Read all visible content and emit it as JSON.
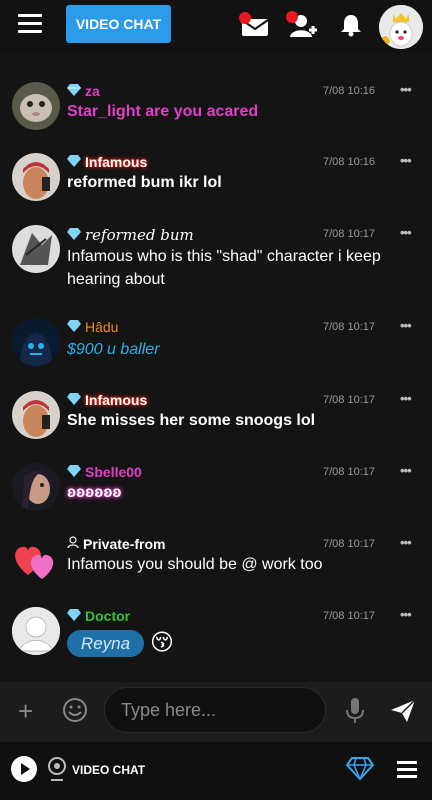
{
  "header": {
    "video_chat_label": "VIDEO CHAT",
    "colors": {
      "accent": "#2b9bea",
      "notify": "#e8191f"
    }
  },
  "messages": [
    {
      "name": "za",
      "name_color": "#e23ec8",
      "badge": "diamond",
      "time": "7/08 10:16",
      "text": "Star_light are you acared",
      "text_color": "#e23ec8",
      "text_style": "bold"
    },
    {
      "name": "Infamous",
      "name_color": "#ffffff",
      "name_glow": "#d11",
      "badge": "diamond",
      "time": "7/08 10:16",
      "text": "reformed bum ikr lol",
      "text_color": "#ffffff",
      "text_style": "bold"
    },
    {
      "name": "reformed bum",
      "name_color": "#ffffff",
      "badge": "diamond",
      "time": "7/08 10:17",
      "text": "Infamous who is this \"shad\" character i keep hearing about",
      "text_color": "#ffffff",
      "text_style": "normal"
    },
    {
      "name": "Hâdu",
      "name_color": "#f08a24",
      "badge": "diamond",
      "time": "7/08 10:17",
      "text": "$900 u baller",
      "text_color": "#2bb0e8",
      "text_style": "italic"
    },
    {
      "name": "Infamous",
      "name_color": "#ffffff",
      "name_glow": "#d11",
      "badge": "diamond",
      "time": "7/08 10:17",
      "text": "She misses her some snoogs lol",
      "text_color": "#ffffff",
      "text_style": "bold"
    },
    {
      "name": "Sbelle00",
      "name_color": "#e23ec8",
      "badge": "diamond",
      "time": "7/08 10:17",
      "text": "ʚʚʚʚʚʚ",
      "text_color": "#ffffff",
      "text_style": "bold"
    },
    {
      "name": "Private-from",
      "name_color": "#ffffff",
      "badge": "person",
      "time": "7/08 10:17",
      "text": "Infamous you should be @ work too",
      "text_color": "#ffffff",
      "text_style": "normal"
    },
    {
      "name": "Doctor",
      "name_color": "#36c23a",
      "badge": "diamond",
      "time": "7/08 10:17",
      "sticker": "Reyna",
      "emoji": "😚"
    }
  ],
  "composer": {
    "placeholder": "Type here..."
  },
  "footer": {
    "video_chat_label": "VIDEO CHAT"
  }
}
